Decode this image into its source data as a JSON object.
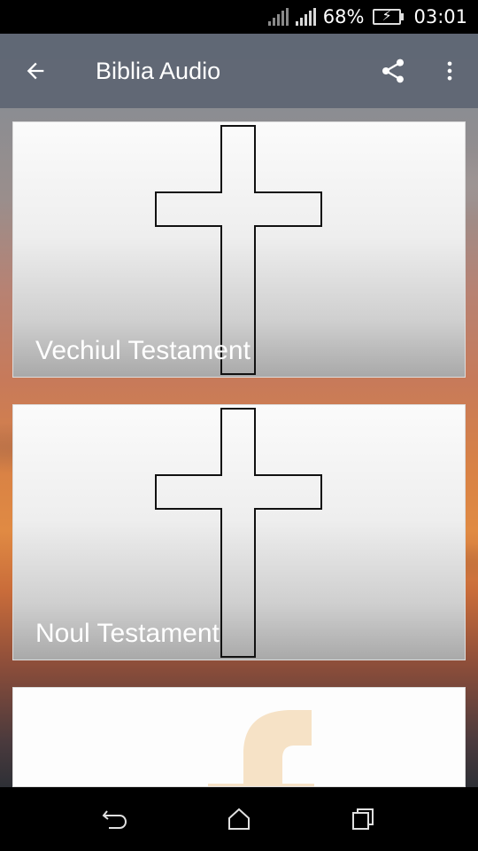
{
  "status_bar": {
    "battery_percent": "68%",
    "time": "03:01"
  },
  "toolbar": {
    "title": "Biblia Audio",
    "back_icon": "arrow-left-icon",
    "share_icon": "share-icon",
    "menu_icon": "more-vert-icon"
  },
  "cards": [
    {
      "label": "Vechiul Testament",
      "icon": "cross-icon"
    },
    {
      "label": "Noul Testament",
      "icon": "cross-icon"
    },
    {
      "label": "",
      "icon": "facebook-icon"
    }
  ],
  "nav_bar": {
    "back_icon": "nav-back-icon",
    "home_icon": "home-icon",
    "recents_icon": "recents-icon"
  },
  "colors": {
    "toolbar": "#5f6674",
    "card_label": "#ffffff",
    "facebook_faded": "#f6e2c6"
  }
}
